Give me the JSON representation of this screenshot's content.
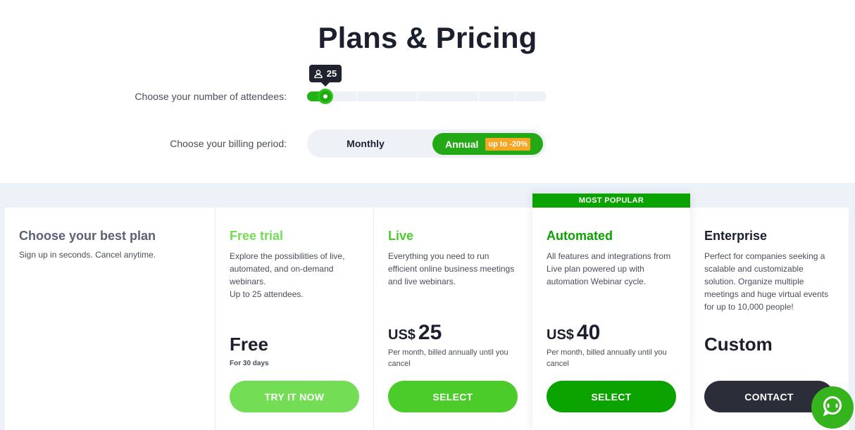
{
  "header": {
    "title": "Plans & Pricing"
  },
  "attendees": {
    "label": "Choose your number of attendees:",
    "value": "25",
    "icon": "user-icon"
  },
  "billing": {
    "label": "Choose your billing period:",
    "monthly_label": "Monthly",
    "annual_label": "Annual",
    "discount_badge": "up to -20%",
    "selected": "Annual"
  },
  "intro": {
    "title": "Choose your best plan",
    "subtitle": "Sign up in seconds. Cancel anytime."
  },
  "plans": [
    {
      "name": "Free trial",
      "description": "Explore the possibilities of live, automated, and on-demand webinars.",
      "extra": "Up to 25 attendees.",
      "price": "Free",
      "price_note": "For 30 days",
      "button": "TRY IT NOW",
      "color": "#74dd56"
    },
    {
      "name": "Live",
      "description": "Everything you need to run efficient online business meetings and live webinars.",
      "currency": "US$",
      "amount": "25",
      "price_note": "Per month, billed annually until you cancel",
      "button": "SELECT",
      "color": "#4ccc2b"
    },
    {
      "name": "Automated",
      "badge": "MOST POPULAR",
      "description": "All features and integrations from Live plan powered up with automation Webinar cycle.",
      "currency": "US$",
      "amount": "40",
      "price_note": "Per month, billed annually until you cancel",
      "button": "SELECT",
      "color": "#0aa300"
    },
    {
      "name": "Enterprise",
      "description": "Perfect for companies seeking a scalable and customizable solution. Organize multiple meetings and huge virtual events for up to 10,000 people!",
      "price": "Custom",
      "button": "CONTACT",
      "color": "#2b2d38"
    }
  ],
  "colors": {
    "accent_green": "#22a915",
    "discount_orange": "#f5a623",
    "dark": "#1c1f2e",
    "chat_green": "#35b41d"
  },
  "chat": {
    "icon": "chat-icon"
  }
}
